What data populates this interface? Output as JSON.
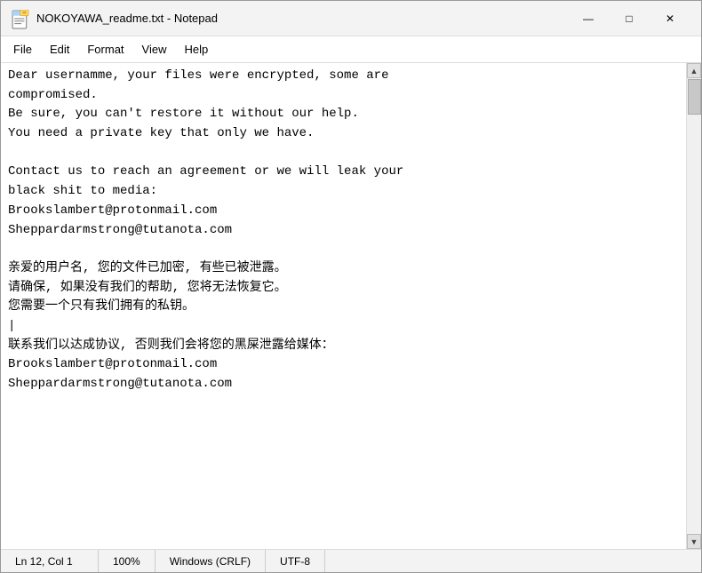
{
  "window": {
    "title": "NOKOYAWA_readme.txt - Notepad",
    "icon_label": "notepad-icon"
  },
  "title_bar": {
    "title": "NOKOYAWA_readme.txt - Notepad"
  },
  "window_controls": {
    "minimize": "—",
    "maximize": "□",
    "close": "✕"
  },
  "menu": {
    "items": [
      "File",
      "Edit",
      "Format",
      "View",
      "Help"
    ]
  },
  "content": {
    "text": "Dear usernamme, your files were encrypted, some are\ncompromised.\nBe sure, you can't restore it without our help.\nYou need a private key that only we have.\n\nContact us to reach an agreement or we will leak your\nblack shit to media:\nBrookslambert@protonmail.com\nSheppardarmstrong@tutanota.com\n\n亲爱的用户名, 您的文件已加密, 有些已被泄露。\n请确保, 如果没有我们的帮助, 您将无法恢复它。\n您需要一个只有我们拥有的私钥。\n|\n联系我们以达成协议, 否则我们会将您的黑屎泄露给媒体：\nBrookslambert@protonmail.com\nSheppardarmstrong@tutanota.com"
  },
  "status_bar": {
    "position": "Ln 12, Col 1",
    "zoom": "100%",
    "line_ending": "Windows (CRLF)",
    "encoding": "UTF-8"
  }
}
